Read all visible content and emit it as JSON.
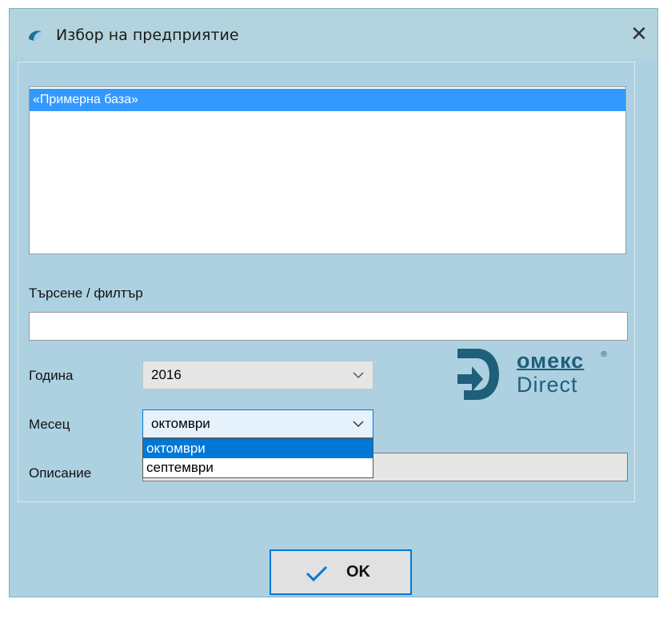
{
  "window": {
    "title": "Избор на предприятие",
    "close_glyph": "✕",
    "app_icon": "app-logo-icon"
  },
  "list": {
    "items": [
      "«Примерна база»"
    ],
    "selected_index": 0
  },
  "search": {
    "label": "Търсене / филтър",
    "value": ""
  },
  "year": {
    "label": "Година",
    "value": "2016"
  },
  "month": {
    "label": "Месец",
    "value": "октомври",
    "options": [
      "октомври",
      "септември"
    ],
    "highlighted_index": 0
  },
  "description": {
    "label": "Описание",
    "value": ""
  },
  "logo": {
    "name": "омекс",
    "sub": "Direct",
    "reg": "®"
  },
  "buttons": {
    "ok_label": "OK",
    "ok_icon": "checkmark-icon"
  },
  "colors": {
    "window_bg": "#add1e1",
    "selection": "#3399ff",
    "accent": "#0078d7",
    "logo": "#1e5f7a"
  }
}
